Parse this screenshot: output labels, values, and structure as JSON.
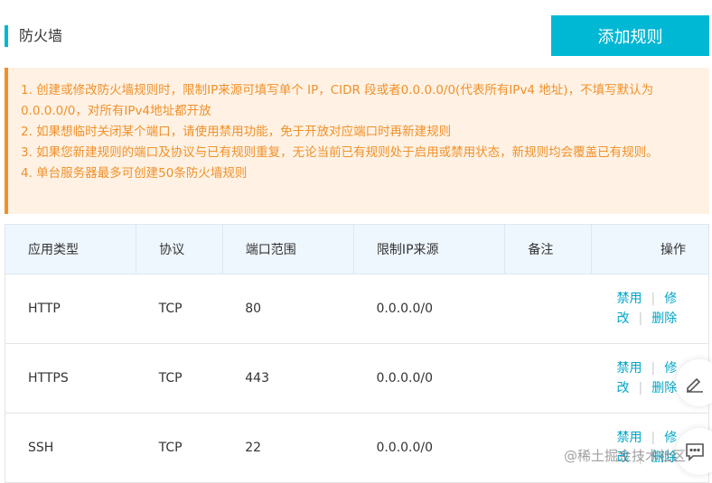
{
  "title": "防火墙",
  "add_button": "添加规则",
  "notice": [
    "1. 创建或修改防火墙规则时，限制IP来源可填写单个 IP，CIDR 段或者0.0.0.0/0(代表所有IPv4 地址)，不填写默认为0.0.0.0/0，对所有IPv4地址都开放",
    "2. 如果想临时关闭某个端口，请使用禁用功能，免于开放对应端口时再新建规则",
    "3. 如果您新建规则的端口及协议与已有规则重复，无论当前已有规则处于启用或禁用状态，新规则均会覆盖已有规则。",
    "4. 单台服务器最多可创建50条防火墙规则"
  ],
  "columns": [
    "应用类型",
    "协议",
    "端口范围",
    "限制IP来源",
    "备注",
    "操作"
  ],
  "rows": [
    {
      "app": "HTTP",
      "protocol": "TCP",
      "port": "80",
      "ip": "0.0.0.0/0",
      "note": ""
    },
    {
      "app": "HTTPS",
      "protocol": "TCP",
      "port": "443",
      "ip": "0.0.0.0/0",
      "note": ""
    },
    {
      "app": "SSH",
      "protocol": "TCP",
      "port": "22",
      "ip": "0.0.0.0/0",
      "note": ""
    }
  ],
  "actions": {
    "disable": "禁用",
    "edit": "修改",
    "delete": "删除"
  },
  "watermark": "@稀土掘金技术社区"
}
